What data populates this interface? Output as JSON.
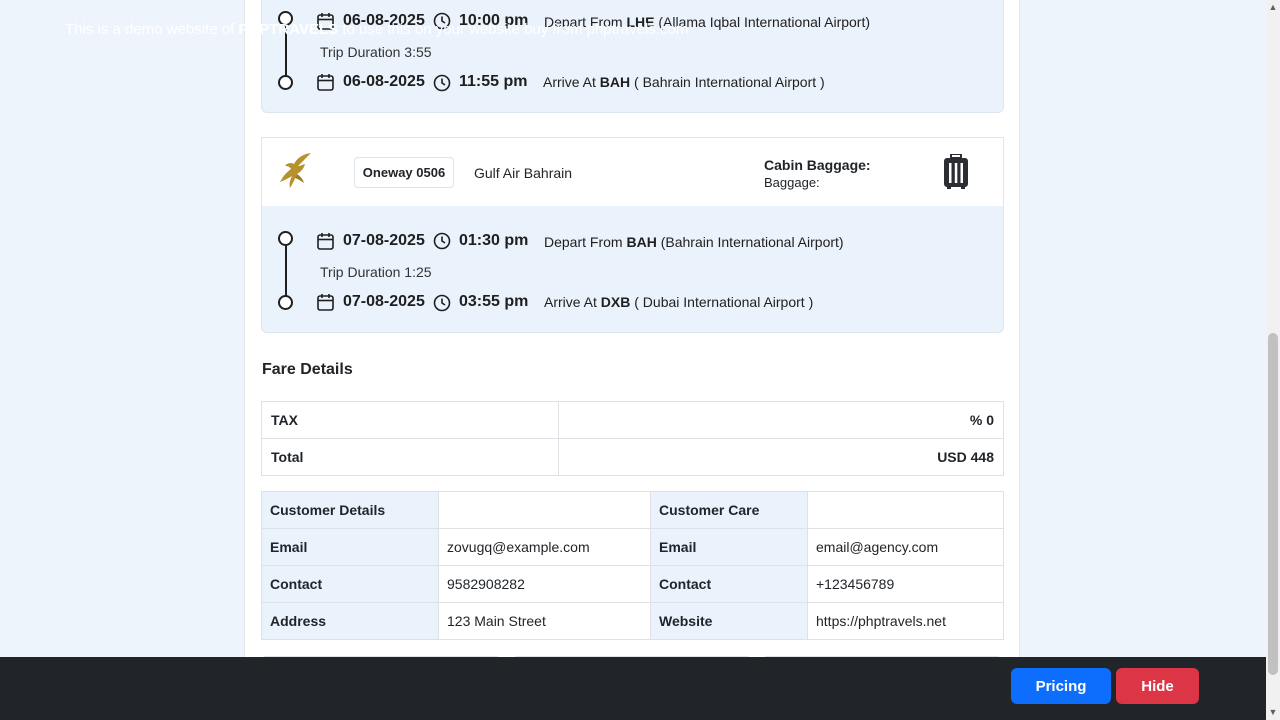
{
  "segments": [
    {
      "depart_date": "06-08-2025",
      "depart_time": "10:00 pm",
      "depart_prefix": "Depart From",
      "depart_code": "LHE",
      "depart_airport": "(Allama Iqbal International Airport)",
      "duration": "Trip Duration 3:55",
      "arrive_date": "06-08-2025",
      "arrive_time": "11:55 pm",
      "arrive_prefix": "Arrive At",
      "arrive_code": "BAH",
      "arrive_airport": "( Bahrain International Airport )"
    },
    {
      "flight_label": "Oneway 0506",
      "airline": "Gulf Air Bahrain",
      "cabin_baggage": "Cabin Baggage:",
      "baggage": "Baggage:",
      "depart_date": "07-08-2025",
      "depart_time": "01:30 pm",
      "depart_prefix": "Depart From",
      "depart_code": "BAH",
      "depart_airport": "(Bahrain International Airport)",
      "duration": "Trip Duration 1:25",
      "arrive_date": "07-08-2025",
      "arrive_time": "03:55 pm",
      "arrive_prefix": "Arrive At",
      "arrive_code": "DXB",
      "arrive_airport": "( Dubai International Airport )"
    }
  ],
  "fare": {
    "title": "Fare Details",
    "rows": [
      {
        "label": "TAX",
        "value": "% 0"
      },
      {
        "label": "Total",
        "value": "USD 448"
      }
    ]
  },
  "customer": {
    "header_left": "Customer Details",
    "header_right": "Customer Care",
    "rows": [
      {
        "l_label": "Email",
        "l_value": "zovugq@example.com",
        "r_label": "Email",
        "r_value": "email@agency.com"
      },
      {
        "l_label": "Contact",
        "l_value": "9582908282",
        "r_label": "Contact",
        "r_value": "+123456789"
      },
      {
        "l_label": "Address",
        "l_value": "123 Main Street",
        "r_label": "Website",
        "r_value": "https://phptravels.net"
      }
    ]
  },
  "demo_bar": {
    "text_before": "This is a demo website of",
    "brand": "PHPTRAVELS",
    "text_after": "to use this on your website buy from phptravels.com",
    "pricing_label": "Pricing",
    "hide_label": "Hide"
  },
  "colors": {
    "accent": "#0d6efd",
    "danger": "#dc3545",
    "leg_background": "#eaf2fb",
    "demo_bar": "#212529"
  },
  "icons": [
    "calendar-icon",
    "clock-icon",
    "airline-logo",
    "luggage-icon"
  ]
}
